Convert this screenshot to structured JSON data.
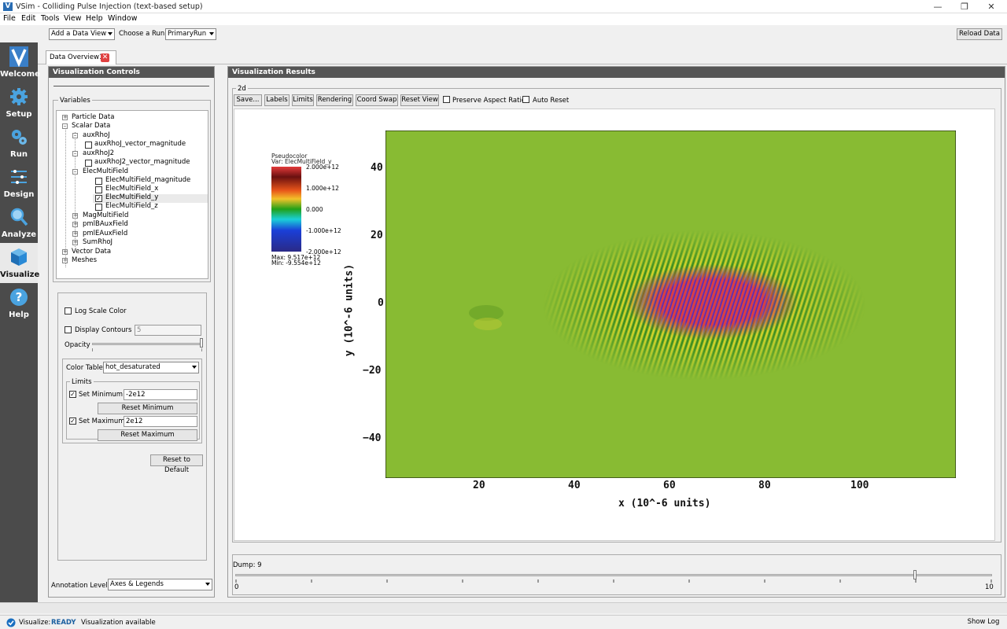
{
  "window": {
    "title": "VSim - Colliding Pulse Injection (text-based setup)"
  },
  "menu": [
    "File",
    "Edit",
    "Tools",
    "View",
    "Help",
    "Window"
  ],
  "toolbar": {
    "data_view": "Add a Data View",
    "choose_run_label": "Choose a Run:",
    "run": "PrimaryRun",
    "reload": "Reload Data"
  },
  "rail": [
    {
      "label": "Welcome",
      "icon": "vsim-logo-icon"
    },
    {
      "label": "Setup",
      "icon": "gear-icon"
    },
    {
      "label": "Run",
      "icon": "gears-icon"
    },
    {
      "label": "Design",
      "icon": "ruler-icon"
    },
    {
      "label": "Analyze",
      "icon": "magnifier-icon"
    },
    {
      "label": "Visualize",
      "icon": "cube-icon"
    },
    {
      "label": "Help",
      "icon": "question-icon"
    }
  ],
  "tab": {
    "label": "Data Overview1"
  },
  "left": {
    "header": "Visualization Controls",
    "variables_title": "Variables",
    "tree": {
      "particle": "Particle Data",
      "scalar": "Scalar Data",
      "auxRhoJ": "auxRhoJ",
      "auxRhoJ_mag": "auxRhoJ_vector_magnitude",
      "auxRhoJ2": "auxRhoJ2",
      "auxRhoJ2_mag": "auxRhoJ2_vector_magnitude",
      "elec": "ElecMultiField",
      "elec_mag": "ElecMultiField_magnitude",
      "elec_x": "ElecMultiField_x",
      "elec_y": "ElecMultiField_y",
      "elec_z": "ElecMultiField_z",
      "mag": "MagMultiField",
      "pmlB": "pmlBAuxField",
      "pmlE": "pmlEAuxField",
      "sumrho": "SumRhoJ",
      "vector": "Vector Data",
      "meshes": "Meshes"
    },
    "log_scale": "Log Scale Color",
    "display_contours": "Display Contours",
    "contours_value": "5",
    "opacity": "Opacity",
    "opacity_level": 1.0,
    "color_table_label": "Color Table",
    "color_table": "hot_desaturated",
    "limits_title": "Limits",
    "set_min": "Set Minimum",
    "min_value": "-2e12",
    "reset_min": "Reset Minimum",
    "set_max": "Set Maximum",
    "max_value": "2e12",
    "reset_max": "Reset Maximum",
    "reset_default": "Reset to Default",
    "annotation_label": "Annotation Level:",
    "annotation_value": "Axes & Legends"
  },
  "right": {
    "header": "Visualization Results",
    "group": "2d",
    "buttons": [
      "Save...",
      "Labels",
      "Limits",
      "Rendering",
      "Coord Swap",
      "Reset View"
    ],
    "preserve": "Preserve Aspect Ratio",
    "auto_reset": "Auto Reset",
    "dump_label": "Dump: 9",
    "dump_min": "0",
    "dump_max": "10",
    "dump_value": 9
  },
  "legend": {
    "title": "Pseudocolor",
    "var": "Var: ElecMultiField_y",
    "ticks": [
      "2.000e+12",
      "1.000e+12",
      "0.000",
      "-1.000e+12",
      "-2.000e+12"
    ],
    "max": "Max:  9.517e+12",
    "min": "Min: -9.554e+12"
  },
  "chart_data": {
    "type": "heatmap",
    "xlabel": "x (10^-6 units)",
    "ylabel": "y (10^-6 units)",
    "x_ticks": [
      "20",
      "40",
      "60",
      "80",
      "100"
    ],
    "y_ticks": [
      "40",
      "20",
      "0",
      "−20",
      "−40"
    ],
    "xlim": [
      0,
      120
    ],
    "ylim": [
      -50,
      50
    ],
    "colors": {
      "background": "#88bb33",
      "field_high": "#cc2233",
      "field_low": "#3322aa"
    }
  },
  "status": {
    "label": "Visualize:",
    "state": "READY",
    "message": "Visualization available",
    "show_log": "Show Log",
    "state_color": "#1a5fa0"
  }
}
